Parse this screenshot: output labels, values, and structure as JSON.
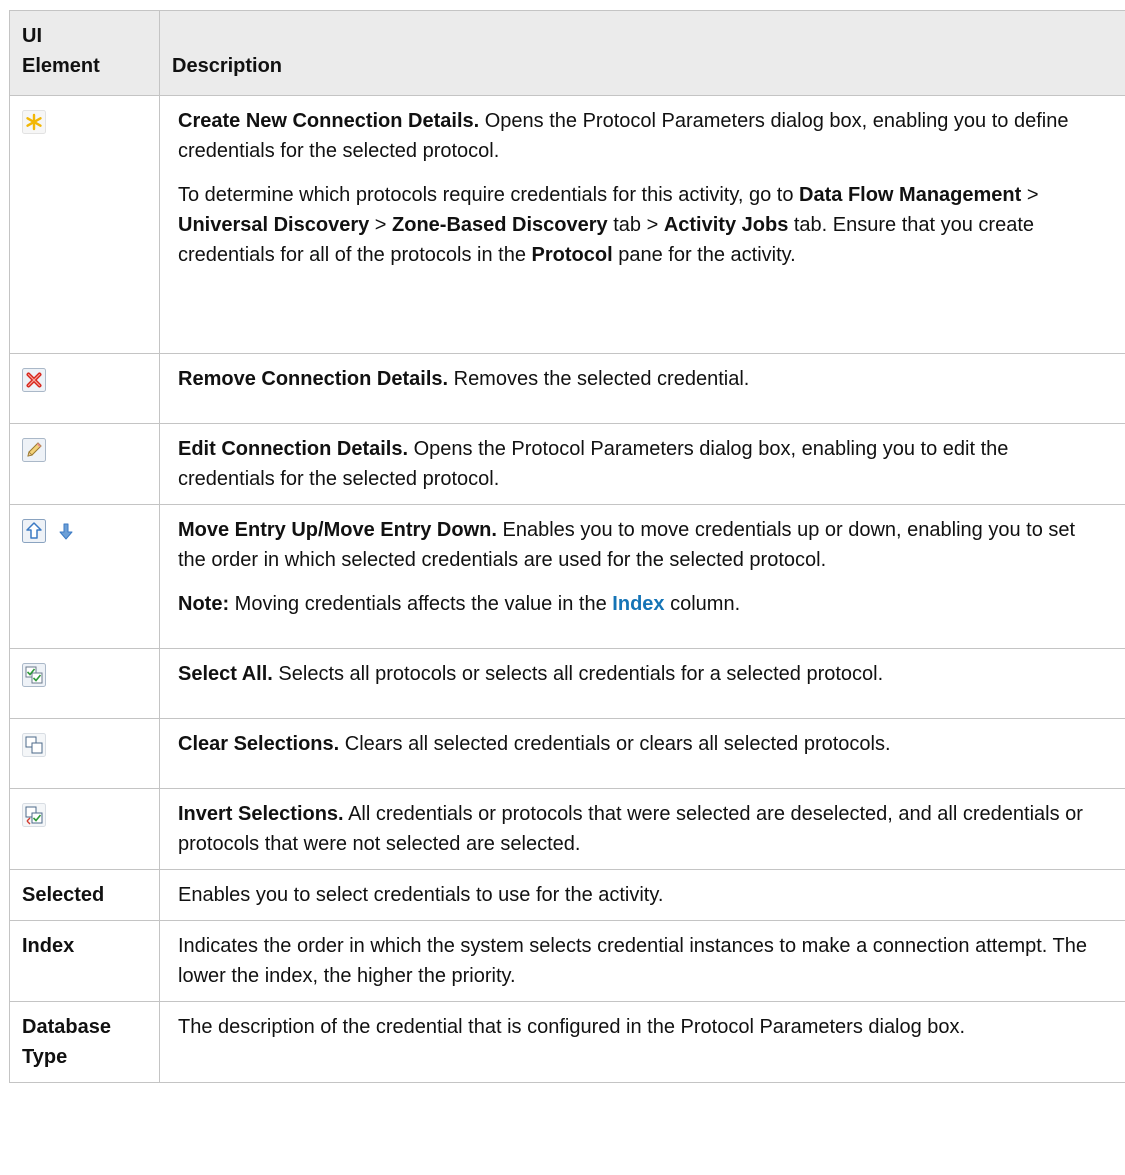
{
  "header": {
    "col1": "UI Element",
    "col1_line1": "UI",
    "col1_line2": "Element",
    "col2": "Description"
  },
  "rows": {
    "create": {
      "icon": "asterisk-new-icon",
      "title": "Create New Connection Details.",
      "text": " Opens the Protocol Parameters dialog box, enabling you to define credentials for the selected protocol.",
      "p2": {
        "t1": "To determine which protocols require credentials for this activity, go to ",
        "b1": "Data Flow Management",
        "t2": " > ",
        "b2": "Universal Discovery",
        "t3": " > ",
        "b3": "Zone-Based Discovery",
        "t4": " tab > ",
        "b4": "Activity Jobs",
        "t5": " tab. Ensure that you create credentials for all of the protocols in the ",
        "b5": "Protocol",
        "t6": " pane for the activity."
      }
    },
    "remove": {
      "icon": "red-x-icon",
      "title": "Remove Connection Details.",
      "text": " Removes the selected credential."
    },
    "edit": {
      "icon": "pencil-icon",
      "title": "Edit Connection Details.",
      "text": " Opens the Protocol Parameters dialog box, enabling you to edit the credentials for the selected protocol."
    },
    "move": {
      "icons": [
        "move-up-icon",
        "move-down-icon"
      ],
      "title": "Move Entry Up/Move Entry Down.",
      "text": " Enables you to move credentials up or down, enabling you to set the order in which selected credentials are used for the selected protocol.",
      "note_label": "Note:",
      "note_t1": " Moving credentials affects the value in the ",
      "note_link": "Index",
      "note_t2": " column."
    },
    "select_all": {
      "icon": "select-all-icon",
      "title": "Select All.",
      "text": " Selects all protocols or selects all credentials for a selected protocol."
    },
    "clear": {
      "icon": "clear-selections-icon",
      "title": "Clear Selections.",
      "text": " Clears all selected credentials or clears all selected protocols."
    },
    "invert": {
      "icon": "invert-selections-icon",
      "title": "Invert Selections.",
      "text": " All credentials or protocols that were selected are deselected, and all credentials or protocols that were not selected are selected."
    },
    "selected": {
      "label": "Selected",
      "text": "Enables you to select credentials to use for the activity."
    },
    "index": {
      "label": "Index",
      "text": "Indicates the order in which the system selects credential instances to make a connection attempt. The lower the index, the higher the priority."
    },
    "dbtype": {
      "label_line1": "Database",
      "label_line2": "Type",
      "text": "The description of the credential that is configured in the Protocol Parameters dialog box."
    }
  },
  "colors": {
    "header_bg": "#ebebeb",
    "border": "#c4c4c4",
    "link": "#1574b6"
  }
}
